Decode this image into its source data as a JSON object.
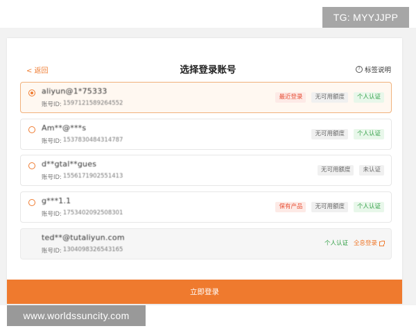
{
  "tg_badge": "TG: MYYJJPP",
  "watermark": "www.worldssuncity.com",
  "header": {
    "back_label": "< 返回",
    "title": "选择登录账号",
    "help_label": "标签说明",
    "help_glyph": "?"
  },
  "accounts": [
    {
      "name": "aliyun@1*75333",
      "id_prefix": "账号ID:",
      "id_value": "1597121589264552",
      "selected": true,
      "tags": [
        "最近登录",
        "无可用额度",
        "个人认证"
      ]
    },
    {
      "name": "Am**@***s",
      "id_prefix": "账号ID:",
      "id_value": "1537830484314787",
      "selected": false,
      "tags": [
        "无可用额度",
        "个人认证"
      ]
    },
    {
      "name": "d**gtal**gues",
      "id_prefix": "账号ID:",
      "id_value": "1556171902551413",
      "selected": false,
      "tags": [
        "无可用额度",
        "未认证"
      ]
    },
    {
      "name": "g***1.1",
      "id_prefix": "账号ID:",
      "id_value": "1753402092508301",
      "selected": false,
      "tags": [
        "保有产品",
        "无可用额度",
        "个人认证"
      ]
    },
    {
      "name": "ted**@tutaliyun.com",
      "id_prefix": "账号ID:",
      "id_value": "1304098326543165",
      "selected": false,
      "tags": [
        "个人认证",
        "全息登录"
      ]
    }
  ],
  "login_button": "立即登录"
}
